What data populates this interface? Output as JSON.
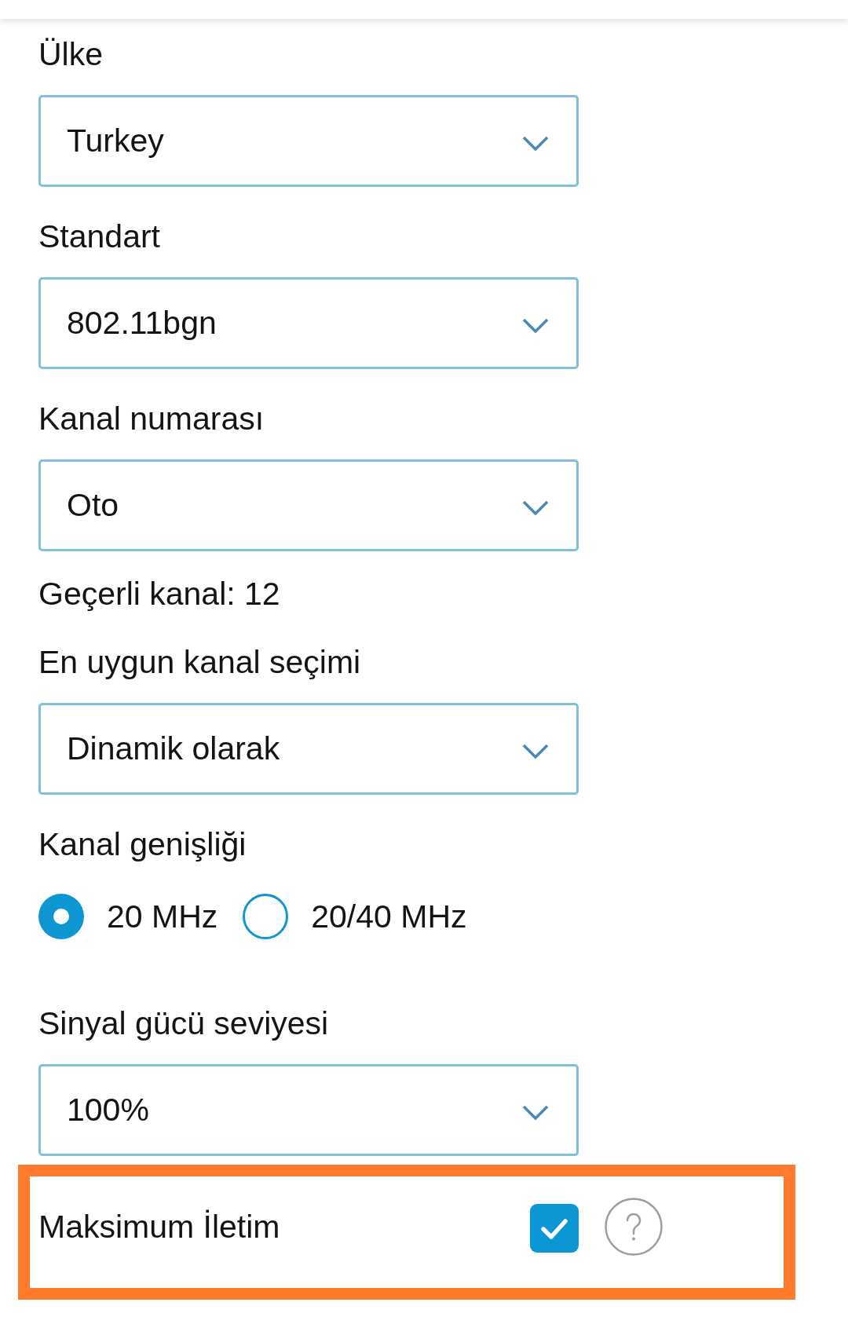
{
  "fields": [
    {
      "kind": "select",
      "label": "Ülke",
      "value": "Turkey"
    },
    {
      "kind": "select",
      "label": "Standart",
      "value": "802.11bgn"
    },
    {
      "kind": "select",
      "label": "Kanal numarası",
      "value": "Oto"
    },
    {
      "kind": "info",
      "text": "Geçerli kanal: 12"
    },
    {
      "kind": "select",
      "label": "En uygun kanal seçimi",
      "value": "Dinamik olarak"
    },
    {
      "kind": "radio",
      "label": "Kanal genişliği",
      "options": [
        {
          "label": "20 MHz",
          "selected": true
        },
        {
          "label": "20/40 MHz",
          "selected": false
        }
      ]
    },
    {
      "kind": "select",
      "label": "Sinyal gücü seviyesi",
      "value": "100%"
    },
    {
      "kind": "checkbox",
      "label": "Maksimum İletim",
      "checked": true,
      "highlighted": true
    }
  ]
}
